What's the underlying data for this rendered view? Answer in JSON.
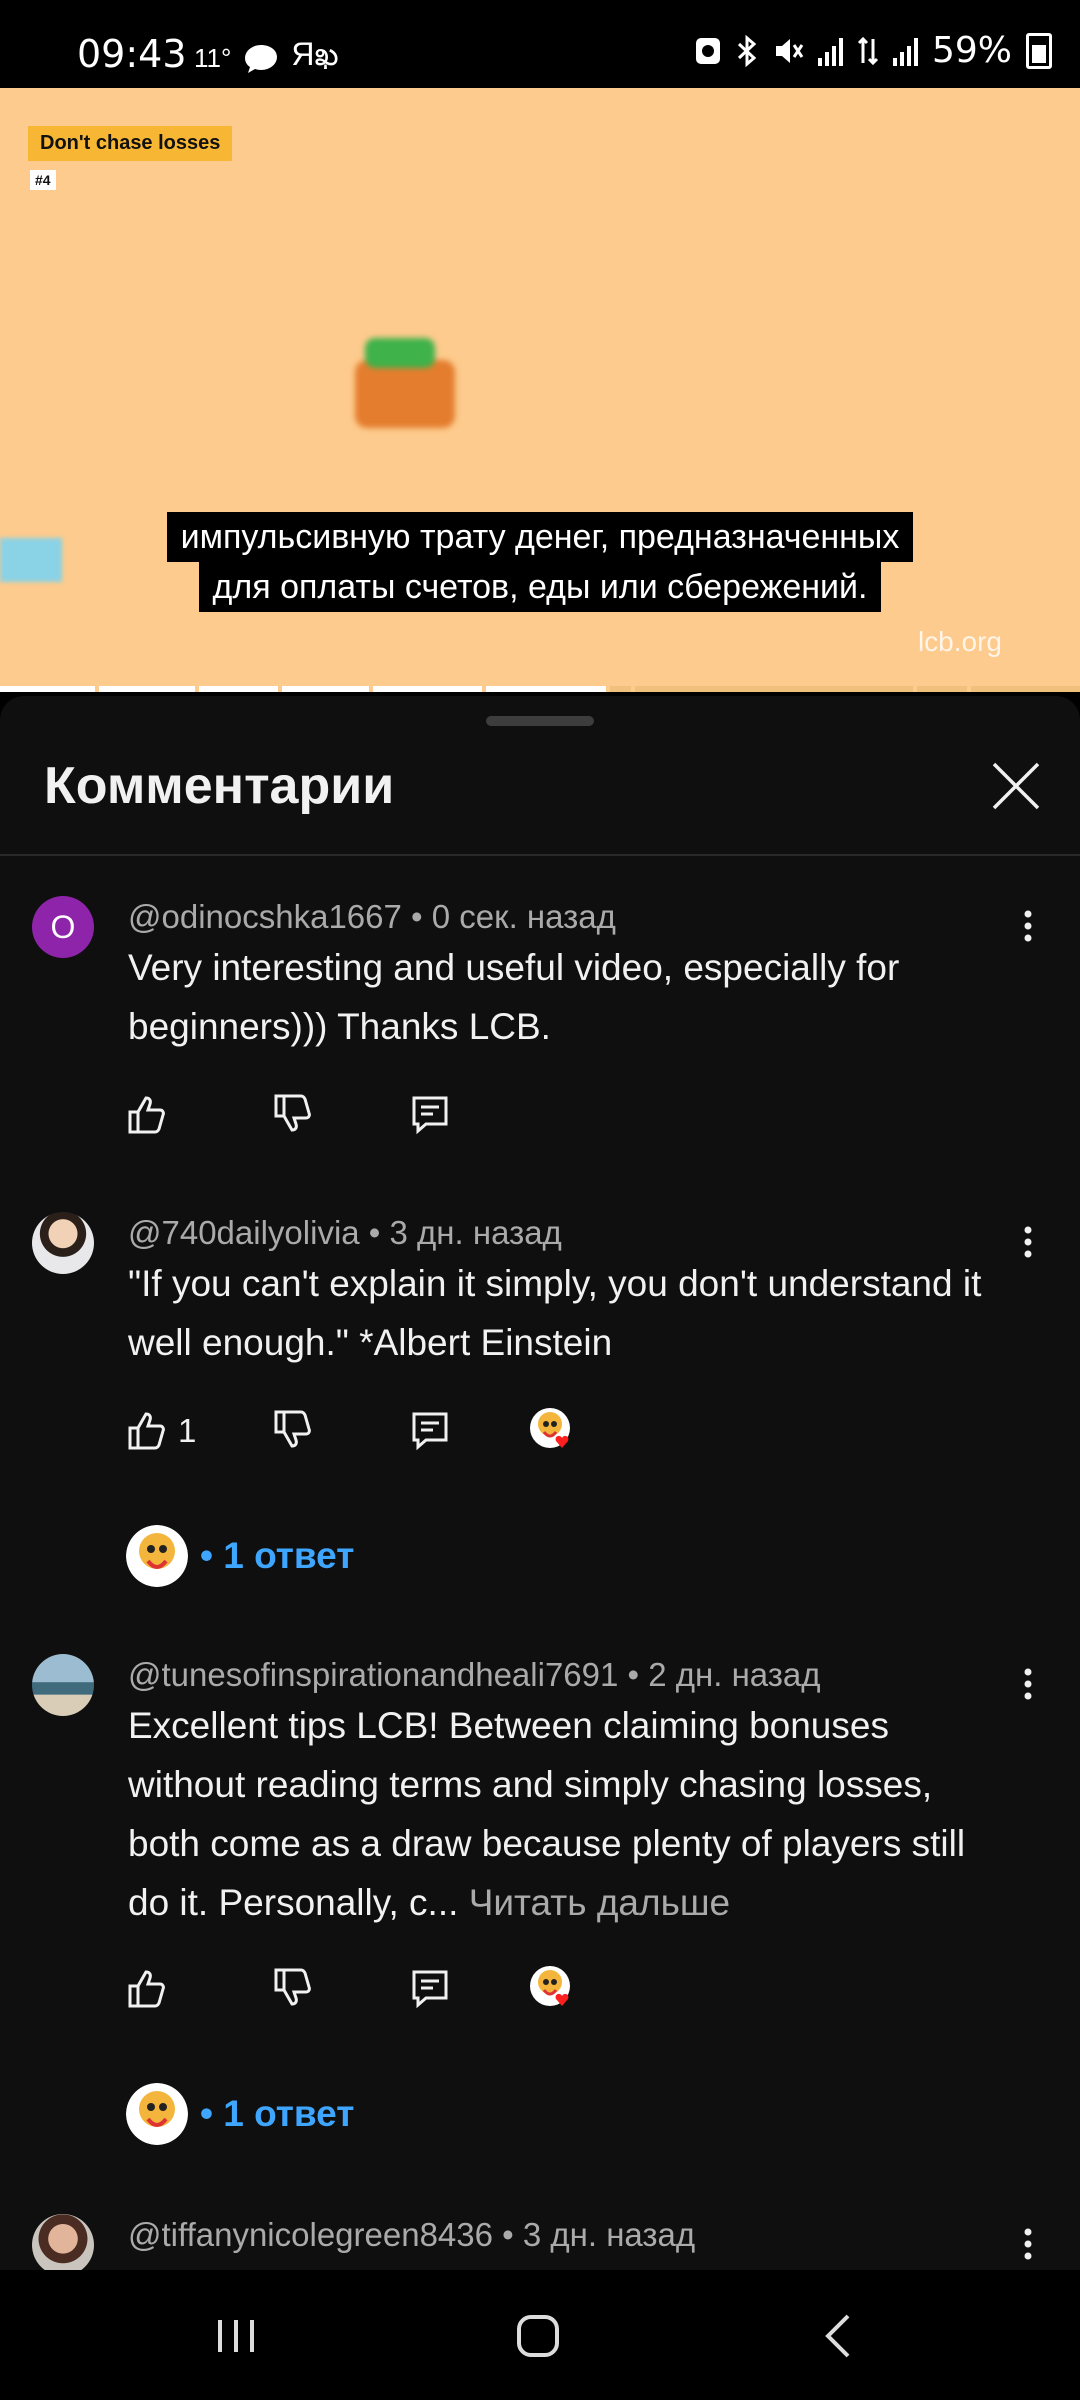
{
  "status_bar": {
    "time": "09:43",
    "temp": "11°",
    "extra": "Яఖ",
    "battery": "59%",
    "battery_level": 0.59
  },
  "video": {
    "tag_label": "Don't chase losses",
    "tag_number": "#4",
    "subtitle_line1": "импульсивную трату денег, предназначенных",
    "subtitle_line2": "для оплаты счетов, еды или сбережений.",
    "watermark": "lcb.org",
    "progress": 0.52
  },
  "panel": {
    "title": "Комментарии"
  },
  "comments": [
    {
      "avatar_letter": "O",
      "avatar_color": "#8e24aa",
      "meta": "@odinocshka1667 • 0 сек. назад",
      "text": "Very interesting and useful video, especially for beginners))) Thanks LCB.",
      "likes": "",
      "creator_heart": false
    },
    {
      "meta": "@740dailyolivia • 3 дн. назад",
      "text": "\"If you can't explain it simply, you don't understand it well enough.\" *Albert Einstein",
      "likes": "1",
      "creator_heart": true,
      "replies": "• 1 ответ"
    },
    {
      "meta": "@tunesofinspirationandheali7691 • 2 дн. назад",
      "text": "Excellent tips LCB! Between claiming bonuses without reading terms and simply chasing losses, both come as a draw because plenty of players still do it. Personally, c...",
      "read_more": "Читать дальше",
      "likes": "",
      "creator_heart": true,
      "replies": "• 1 ответ"
    },
    {
      "meta": "@tiffanynicolegreen8436 • 3 дн. назад"
    }
  ],
  "colors": {
    "video_bg": "#fdcb8d",
    "link_blue": "#3ea6ff",
    "panel_bg": "#0f0f0f"
  }
}
